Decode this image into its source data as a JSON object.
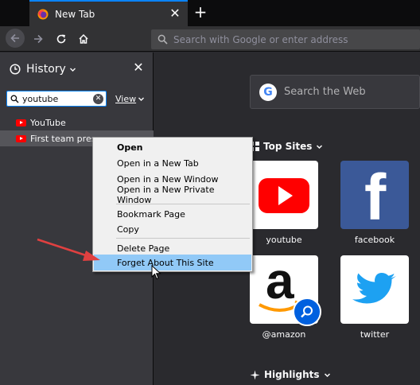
{
  "tabs": {
    "active_title": "New Tab",
    "close_glyph": "✕",
    "new_tab_glyph": "+"
  },
  "navbar": {
    "url_placeholder": "Search with Google or enter address"
  },
  "sidebar": {
    "title": "History",
    "close_glyph": "✕",
    "search_value": "youtube",
    "clear_glyph": "✕",
    "view_label": "View",
    "items": [
      {
        "label": "YouTube"
      },
      {
        "label": "First team preseason"
      }
    ]
  },
  "main": {
    "web_search_placeholder": "Search the Web",
    "google_letter": "G",
    "top_sites_label": "Top Sites",
    "highlights_label": "Highlights",
    "tiles": [
      {
        "label": "youtube"
      },
      {
        "label": "facebook",
        "glyph": "f"
      },
      {
        "label": "@amazon",
        "glyph": "a"
      },
      {
        "label": "twitter"
      }
    ]
  },
  "context_menu": {
    "items": [
      {
        "label": "Open"
      },
      {
        "label": "Open in a New Tab"
      },
      {
        "label": "Open in a New Window"
      },
      {
        "label": "Open in a New Private Window"
      },
      {
        "label": "Bookmark Page"
      },
      {
        "label": "Copy"
      },
      {
        "label": "Delete Page"
      },
      {
        "label": "Forget About This Site"
      }
    ]
  },
  "colors": {
    "accent": "#0a84ff",
    "menu_highlight": "#91c9f7",
    "youtube_red": "#ff0000",
    "facebook_blue": "#3b5998",
    "twitter_blue": "#1da1f2",
    "annotation_arrow": "#e04040"
  }
}
